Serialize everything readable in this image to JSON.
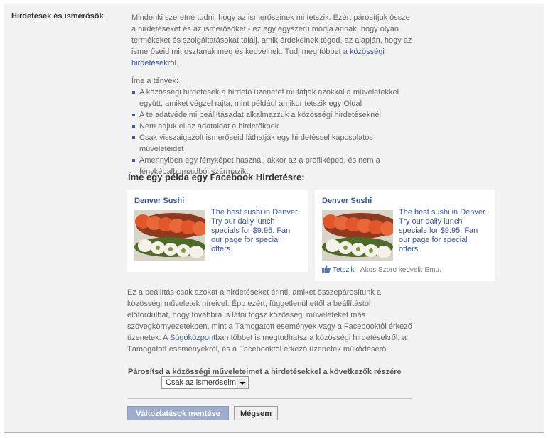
{
  "section": {
    "title": "Hirdetések és ismerősök"
  },
  "intro": {
    "text": "Mindenki szeretné tudni, hogy az ismerőseinek mi tetszik. Ezért párosítjuk össze a hirdetéseket és az ismerősöket - ez egy egyszerű módja annak, hogy olyan termékeket és szolgáltatásokat találj, amik érdekelnek téged, az alapján, hogy az ismerőseid mit osztanak meg és kedvelnek. Tudj meg többet a ",
    "link": "közösségi hirdetések",
    "suffix": "ről."
  },
  "facts": {
    "heading": "Íme a tények:",
    "items": [
      "A közösségi hirdetések a hirdető üzenetét mutatják azokkal a műveletekkel együtt, amiket végzel rajta, mint például amikor tetszik egy Oldal",
      "A te adatvédelmi beállításadat alkalmazzuk a közösségi hirdetéseknél",
      "Nem adjuk el az adataidat a hirdetőknek",
      "Csak visszaigazolt ismerőseid láthatják egy hirdetéssel kapcsolatos műveleteidet",
      "Amennyiben egy fényképet használ, akkor az a profilképed, és nem a fényképalbumaidból származik."
    ]
  },
  "example": {
    "heading": "Íme egy példa egy Facebook Hirdetésre:",
    "ad1": {
      "title": "Denver Sushi",
      "body": "The best sushi in Denver. Try our daily lunch specials for $9.95. Fan our page for special offers."
    },
    "ad2": {
      "title": "Denver Sushi",
      "body": "The best sushi in Denver. Try our daily lunch specials for $9.95. Fan our page for special offers.",
      "like_label": "Tetszik",
      "social_text": " · Akos Szoro kedveli: Emu."
    }
  },
  "bottom": {
    "text": "Ez a beállítás csak azokat a hirdetéseket érinti, amiket összepárosítunk a közösségi műveletek híreivel. Épp ezért, függetlenül ettől a beállítástól előfordulhat, hogy továbbra is látni fogsz közösségi műveleteket más szövegkörnyezetekben, mint a Támogatott események vagy a Facebooktól érkező üzenetek. A ",
    "link": "Súgóközpont",
    "suffix": "ban többet is megtudhatsz a közösségi hirdetésekről, a Támogatott eseményekről, és a Facebooktól érkező üzenetek működéséről."
  },
  "pairing": {
    "label": "Párosítsd a közösségi műveleteimet a hirdetésekkel a következők részére",
    "selected": "Csak az ismerőseim"
  },
  "buttons": {
    "save": "Változtatások mentése",
    "cancel": "Mégsem"
  },
  "colors": {
    "link": "#3b5998",
    "save_button": "#9dadce",
    "panel_bg": "#f2f2f2"
  }
}
